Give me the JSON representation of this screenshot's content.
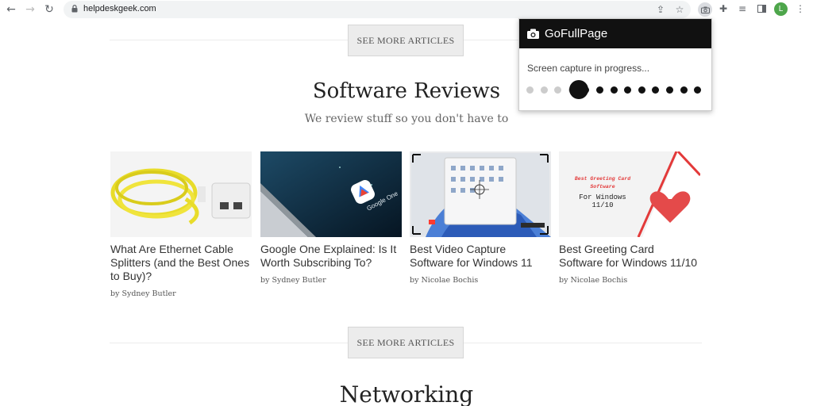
{
  "browser": {
    "url": "helpdeskgeek.com",
    "avatar_letter": "L"
  },
  "page": {
    "see_more_label": "SEE MORE ARTICLES",
    "section": {
      "title": "Software Reviews",
      "subtitle": "We review stuff so you don't have to"
    },
    "next_section_title": "Networking",
    "cards": [
      {
        "title": "What Are Ethernet Cable Splitters (and the Best Ones to Buy)?",
        "author": "by Sydney Butler"
      },
      {
        "title": "Google One Explained: Is It Worth Subscribing To?",
        "author": "by Sydney Butler",
        "thumb_text": "Google One"
      },
      {
        "title": "Best Video Capture Software for Windows 11",
        "author": "by Nicolae Bochis"
      },
      {
        "title": "Best Greeting Card Software for Windows 11/10",
        "author": "by Nicolae Bochis",
        "thumb_text_1": "Best Greeting Card Software",
        "thumb_text_2": "For Windows",
        "thumb_text_3": "11/10"
      }
    ]
  },
  "extension_popup": {
    "title": "GoFullPage",
    "status": "Screen capture in progress...",
    "progress_dots_total": 13,
    "progress_dots_done": 4
  },
  "colors": {
    "popup_header": "#111111",
    "avatar": "#4ea64b",
    "dot_pending": "#cccccc",
    "dot_done": "#111111"
  }
}
